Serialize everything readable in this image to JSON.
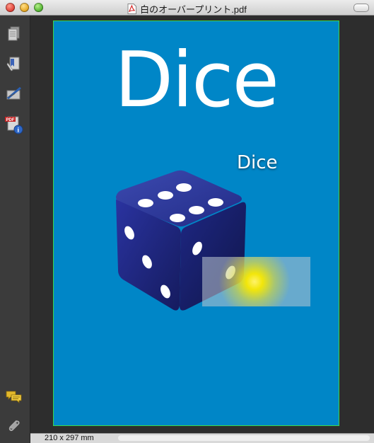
{
  "window": {
    "title": "白のオーバープリント.pdf"
  },
  "sidebar": {
    "items": [
      {
        "name": "pages-icon"
      },
      {
        "name": "bookmarks-icon"
      },
      {
        "name": "signatures-icon"
      },
      {
        "name": "document-info-icon"
      },
      {
        "name": "comments-icon"
      },
      {
        "name": "attachments-icon"
      }
    ]
  },
  "document": {
    "heading": "Dice",
    "subheading": "Dice",
    "background_color": "#0086c7",
    "trim_border_color": "#3bd84a"
  },
  "statusbar": {
    "page_size": "210 x 297 mm"
  }
}
